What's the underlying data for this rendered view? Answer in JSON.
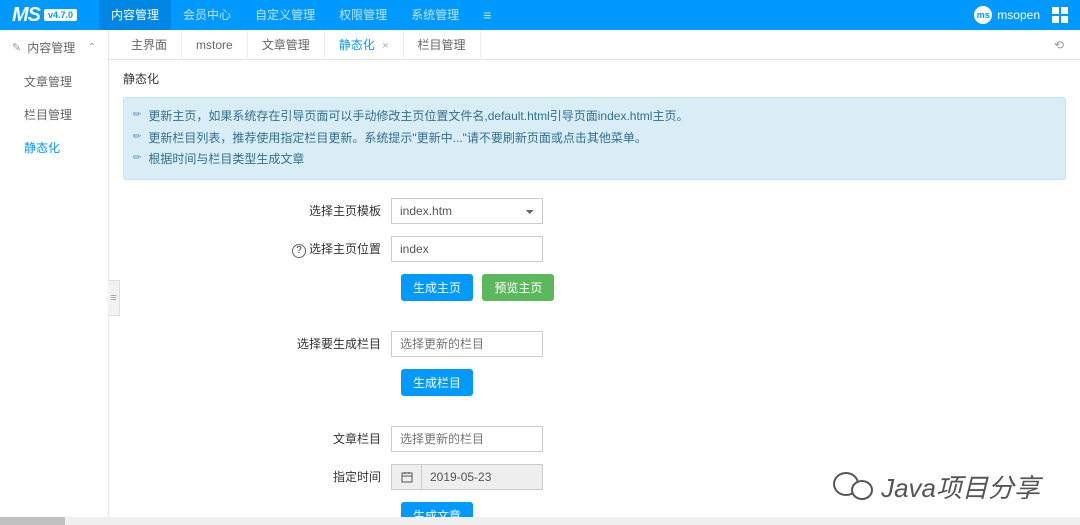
{
  "header": {
    "logo": "MS",
    "version": "v4.7.0",
    "nav": [
      "内容管理",
      "会员中心",
      "自定义管理",
      "权限管理",
      "系统管理"
    ],
    "nav_active": 0,
    "avatar_text": "ms",
    "username": "msopen"
  },
  "sidebar": {
    "title": "内容管理",
    "items": [
      "文章管理",
      "栏目管理",
      "静态化"
    ],
    "active": 2
  },
  "tabs": {
    "items": [
      "主界面",
      "mstore",
      "文章管理",
      "静态化",
      "栏目管理"
    ],
    "active": 3,
    "closable": [
      false,
      false,
      false,
      true,
      false
    ]
  },
  "page": {
    "title": "静态化",
    "alert_lines": [
      "更新主页，如果系统存在引导页面可以手动修改主页位置文件名,default.html引导页面index.html主页。",
      "更新栏目列表，推荐使用指定栏目更新。系统提示\"更新中...\"请不要刷新页面或点击其他菜单。",
      "根据时间与栏目类型生成文章"
    ],
    "section1": {
      "label_template": "选择主页模板",
      "template_value": "index.htm",
      "label_position": "选择主页位置",
      "position_value": "index",
      "btn_generate": "生成主页",
      "btn_preview": "预览主页"
    },
    "section2": {
      "label_column": "选择要生成栏目",
      "column_placeholder": "选择更新的栏目",
      "btn_generate": "生成栏目"
    },
    "section3": {
      "label_article": "文章栏目",
      "article_placeholder": "选择更新的栏目",
      "label_date": "指定时间",
      "date_value": "2019-05-23",
      "btn_generate": "生成文章"
    }
  },
  "watermark": "Java项目分享"
}
